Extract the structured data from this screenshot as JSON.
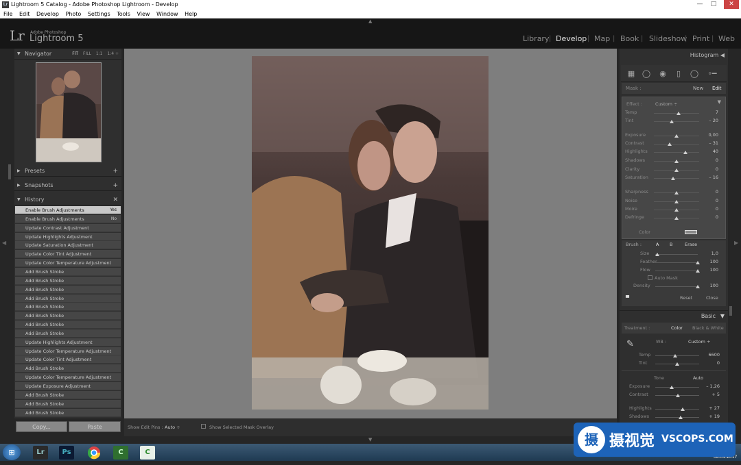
{
  "window": {
    "title": "Lightroom 5 Catalog - Adobe Photoshop Lightroom - Develop",
    "minimize": "—",
    "maximize": "□",
    "close": "✕"
  },
  "menu": [
    "File",
    "Edit",
    "Develop",
    "Photo",
    "Settings",
    "Tools",
    "View",
    "Window",
    "Help"
  ],
  "brand": {
    "logo": "Lr",
    "small": "Adobe Photoshop",
    "name": "Lightroom 5"
  },
  "modules": [
    "Library",
    "Develop",
    "Map",
    "Book",
    "Slideshow",
    "Print",
    "Web"
  ],
  "active_module": "Develop",
  "navigator": {
    "label": "Navigator",
    "options": [
      "FIT",
      "FILL",
      "1:1",
      "1:4 ÷"
    ]
  },
  "panels": {
    "presets": "Presets",
    "snapshots": "Snapshots",
    "history": "History"
  },
  "history": [
    {
      "label": "Enable Brush Adjustments",
      "val": "Yes"
    },
    {
      "label": "Enable Brush Adjustments",
      "val": "No"
    },
    {
      "label": "Update Contrast Adjustment"
    },
    {
      "label": "Update Highlights Adjustment"
    },
    {
      "label": "Update Saturation Adjustment"
    },
    {
      "label": "Update Color Tint Adjustment"
    },
    {
      "label": "Update Color Temperature Adjustment"
    },
    {
      "label": "Add Brush Stroke"
    },
    {
      "label": "Add Brush Stroke"
    },
    {
      "label": "Add Brush Stroke"
    },
    {
      "label": "Add Brush Stroke"
    },
    {
      "label": "Add Brush Stroke"
    },
    {
      "label": "Add Brush Stroke"
    },
    {
      "label": "Add Brush Stroke"
    },
    {
      "label": "Add Brush Stroke"
    },
    {
      "label": "Update Highlights Adjustment"
    },
    {
      "label": "Update Color Temperature Adjustment"
    },
    {
      "label": "Update Color Tint Adjustment"
    },
    {
      "label": "Add Brush Stroke"
    },
    {
      "label": "Update Color Temperature Adjustment"
    },
    {
      "label": "Update Exposure Adjustment"
    },
    {
      "label": "Add Brush Stroke"
    },
    {
      "label": "Add Brush Stroke"
    },
    {
      "label": "Add Brush Stroke"
    }
  ],
  "buttons": {
    "copy": "Copy...",
    "paste": "Paste"
  },
  "toolbar": {
    "show_edit_pins_label": "Show Edit Pins :",
    "show_edit_pins_value": "Auto ÷",
    "mask_overlay": "Show Selected Mask Overlay"
  },
  "right": {
    "histogram": "Histogram",
    "mask": {
      "label": "Mask :",
      "new": "New",
      "edit": "Edit"
    },
    "effect": {
      "label": "Effect :",
      "value": "Custom ÷"
    },
    "sliders": [
      {
        "name": "Temp",
        "val": "7",
        "pos": 0.55
      },
      {
        "name": "Tint",
        "val": "– 20",
        "pos": 0.4
      },
      {
        "name": "Exposure",
        "val": "0,00",
        "pos": 0.5
      },
      {
        "name": "Contrast",
        "val": "– 31",
        "pos": 0.35
      },
      {
        "name": "Highlights",
        "val": "40",
        "pos": 0.7
      },
      {
        "name": "Shadows",
        "val": "0",
        "pos": 0.5
      },
      {
        "name": "Clarity",
        "val": "0",
        "pos": 0.5
      },
      {
        "name": "Saturation",
        "val": "– 16",
        "pos": 0.42
      },
      {
        "name": "Sharpness",
        "val": "0",
        "pos": 0.5
      },
      {
        "name": "Noise",
        "val": "0",
        "pos": 0.5
      },
      {
        "name": "Moire",
        "val": "0",
        "pos": 0.5
      },
      {
        "name": "Defringe",
        "val": "0",
        "pos": 0.5
      }
    ],
    "color_label": "Color",
    "brush": {
      "label": "Brush :",
      "a": "A",
      "b": "B",
      "erase": "Erase"
    },
    "brush_sliders": [
      {
        "name": "Size",
        "val": "1,0",
        "pos": 0.05
      },
      {
        "name": "Feather",
        "val": "100",
        "pos": 1.0
      },
      {
        "name": "Flow",
        "val": "100",
        "pos": 1.0
      }
    ],
    "auto_mask": "Auto Mask",
    "density": {
      "name": "Density",
      "val": "100",
      "pos": 1.0
    },
    "reset": "Reset",
    "close": "Close",
    "basic": "Basic",
    "treatment": {
      "label": "Treatment :",
      "color": "Color",
      "bw": "Black & White"
    },
    "wb": {
      "label": "WB :",
      "value": "Custom ÷"
    },
    "basic_sliders": [
      {
        "name": "Temp",
        "val": "6600",
        "pos": 0.45
      },
      {
        "name": "Tint",
        "val": "0",
        "pos": 0.5
      }
    ],
    "tone": {
      "label": "Tone",
      "auto": "Auto"
    },
    "tone_sliders": [
      {
        "name": "Exposure",
        "val": "– 1,26",
        "pos": 0.37
      },
      {
        "name": "Contrast",
        "val": "+ 5",
        "pos": 0.52
      },
      {
        "name": "Highlights",
        "val": "+ 27",
        "pos": 0.62
      },
      {
        "name": "Shadows",
        "val": "+ 19",
        "pos": 0.58
      }
    ]
  },
  "taskbar": {
    "icons": [
      "Lr",
      "Ps",
      "chrome",
      "C",
      "C"
    ],
    "date": "08.04.2017"
  },
  "watermark": {
    "cn": "摄视觉",
    "en": "VSCOPS.COM"
  }
}
